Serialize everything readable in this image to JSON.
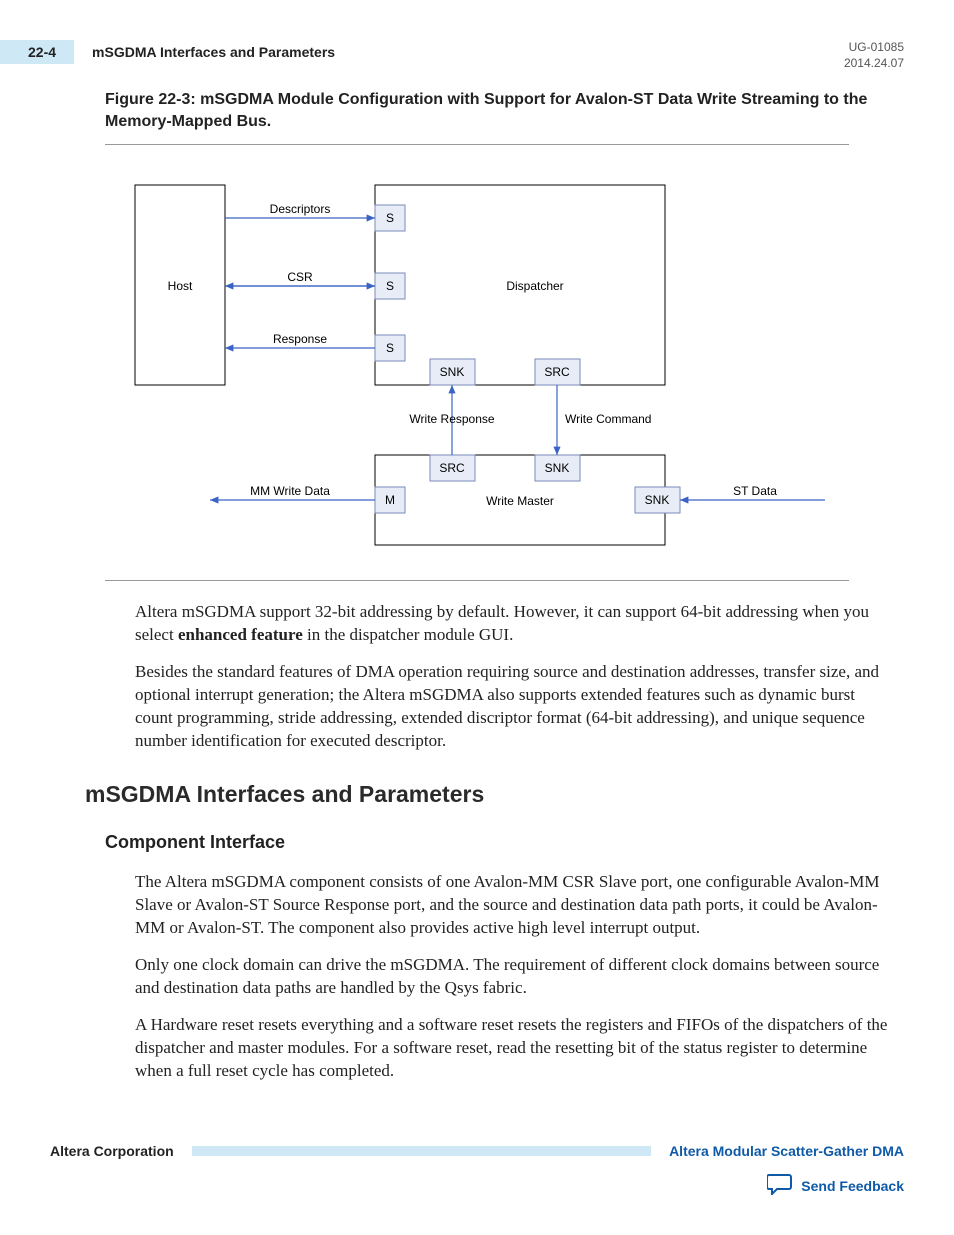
{
  "header": {
    "page_num": "22-4",
    "title": "mSGDMA Interfaces and Parameters",
    "doc_id": "UG-01085",
    "date": "2014.24.07"
  },
  "figure": {
    "caption": "Figure 22-3: mSGDMA Module Configuration with Support for Avalon-ST Data Write Streaming to the Memory-Mapped Bus."
  },
  "diagram": {
    "host": "Host",
    "descriptors": "Descriptors",
    "csr": "CSR",
    "response": "Response",
    "s": "S",
    "dispatcher": "Dispatcher",
    "snk": "SNK",
    "src": "SRC",
    "write_response": "Write Response",
    "write_command": "Write Command",
    "m": "M",
    "write_master": "Write Master",
    "mm_write_data": "MM Write Data",
    "st_data": "ST Data"
  },
  "paragraphs": {
    "p1a": "Altera mSGDMA support 32-bit addressing by default. However, it can support 64-bit addressing when you select ",
    "p1bold": "enhanced feature",
    "p1b": " in the dispatcher module GUI.",
    "p2": "Besides the standard features of DMA operation requiring source and destination addresses, transfer size, and optional interrupt generation; the Altera mSGDMA also supports extended features such as dynamic burst count programming, stride addressing, extended discriptor format (64-bit addressing), and unique sequence number identification for executed descriptor."
  },
  "section": {
    "h2": "mSGDMA Interfaces and Parameters",
    "h3": "Component Interface",
    "p3": "The Altera mSGDMA component consists of one Avalon-MM CSR Slave port, one configurable Avalon-MM Slave or Avalon-ST Source Response port, and the source and destination data path ports, it could be Avalon-MM or Avalon-ST. The component also provides active high level interrupt output.",
    "p4": "Only one clock domain can drive the mSGDMA. The requirement of different clock domains between source and destination data paths are handled by the Qsys fabric.",
    "p5": "A Hardware reset resets everything and a software reset resets the registers and FIFOs of the dispatchers of the dispatcher and master modules. For a software reset, read the resetting bit of the status register to determine when a full reset cycle has completed."
  },
  "footer": {
    "left": "Altera Corporation",
    "right": "Altera Modular Scatter-Gather DMA",
    "feedback": "Send Feedback"
  }
}
